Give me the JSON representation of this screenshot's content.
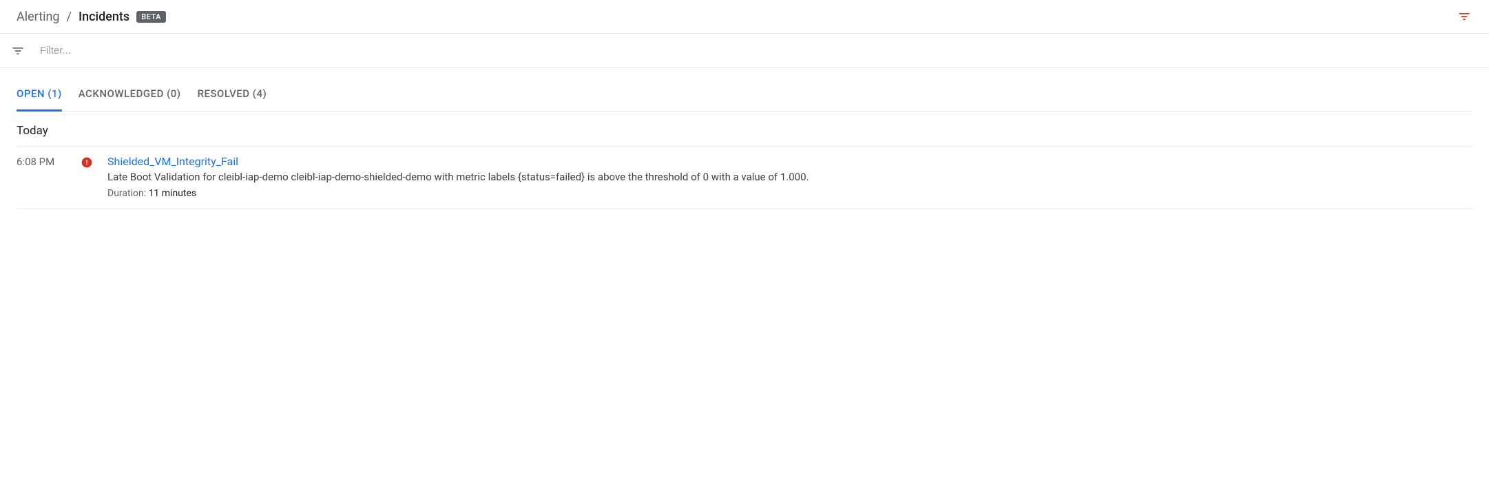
{
  "header": {
    "breadcrumb_parent": "Alerting",
    "breadcrumb_separator": "/",
    "breadcrumb_current": "Incidents",
    "beta_label": "BETA"
  },
  "filter": {
    "placeholder": "Filter..."
  },
  "tabs": {
    "open": {
      "label": "OPEN (1)",
      "active": true
    },
    "acknowledged": {
      "label": "ACKNOWLEDGED (0)",
      "active": false
    },
    "resolved": {
      "label": "RESOLVED (4)",
      "active": false
    }
  },
  "date_header": "Today",
  "incidents": [
    {
      "time": "6:08 PM",
      "title": "Shielded_VM_Integrity_Fail",
      "description": "Late Boot Validation for cleibl-iap-demo cleibl-iap-demo-shielded-demo with metric labels {status=failed} is above the threshold of 0 with a value of 1.000.",
      "duration_label": "Duration: ",
      "duration_value": "11 minutes"
    }
  ]
}
